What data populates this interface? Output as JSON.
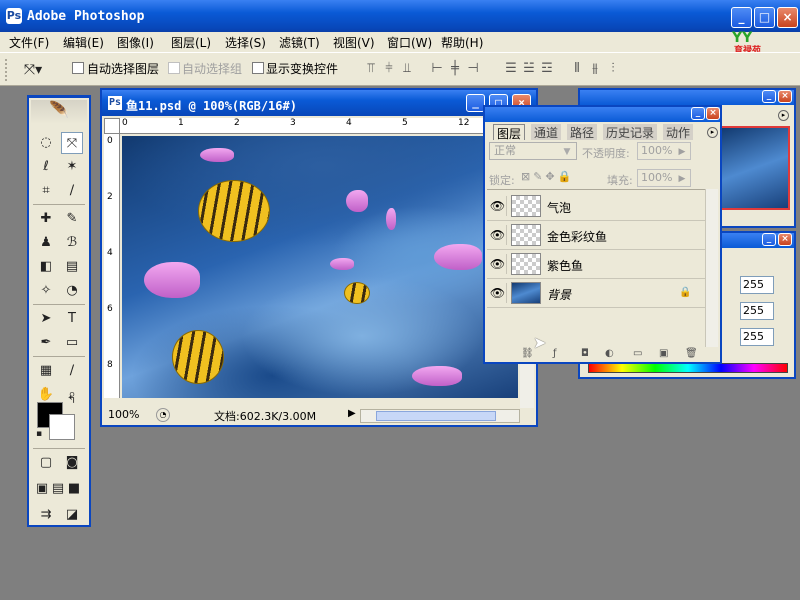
{
  "app": {
    "title": "Adobe Photoshop",
    "logo_text": "YY",
    "logo_sub": "育禄苑"
  },
  "menu": [
    "文件(F)",
    "编辑(E)",
    "图像(I)",
    "图层(L)",
    "选择(S)",
    "滤镜(T)",
    "视图(V)",
    "窗口(W)",
    "帮助(H)"
  ],
  "options": {
    "auto_select_layer": "自动选择图层",
    "auto_select_group": "自动选择组",
    "show_transform": "显示变换控件"
  },
  "document": {
    "title": "鱼11.psd @ 100%(RGB/16#)",
    "zoom": "100%",
    "doc_info": "文档:602.3K/3.00M",
    "ruler_top": [
      "0",
      "1",
      "2",
      "3",
      "4",
      "5",
      "6",
      "7",
      "12"
    ],
    "ruler_left": [
      "0",
      "2",
      "4",
      "6",
      "8"
    ]
  },
  "layers_panel": {
    "tabs": [
      "图层",
      "通道",
      "路径",
      "历史记录",
      "动作"
    ],
    "blend_mode": "正常",
    "opacity_label": "不透明度:",
    "opacity_value": "100%",
    "lock_label": "锁定:",
    "fill_label": "填充:",
    "fill_value": "100%",
    "layers": [
      {
        "name": "气泡",
        "visible": true
      },
      {
        "name": "金色彩纹鱼",
        "visible": true
      },
      {
        "name": "紫色鱼",
        "visible": true
      },
      {
        "name": "背景",
        "visible": true,
        "locked": true
      }
    ]
  },
  "color_panel": {
    "r": "255",
    "g": "255",
    "b": "255"
  },
  "colors": {
    "titlebar": "#0a5ad6",
    "panel_bg": "#ece9d8",
    "workspace": "#7f7f7f",
    "foreground": "#000000",
    "background": "#ffffff"
  }
}
